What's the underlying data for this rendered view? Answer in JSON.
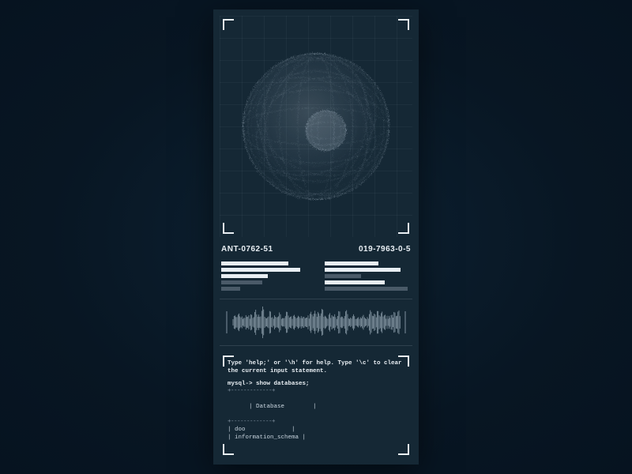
{
  "ids": {
    "left": "ANT-0762-51",
    "right": "019-7963-0-5"
  },
  "bars": {
    "left": [
      {
        "width": 78,
        "dim": false
      },
      {
        "width": 92,
        "dim": false
      },
      {
        "width": 54,
        "dim": false
      },
      {
        "width": 48,
        "dim": true
      },
      {
        "width": 22,
        "dim": true
      }
    ],
    "right": [
      {
        "width": 62,
        "dim": false
      },
      {
        "width": 88,
        "dim": false
      },
      {
        "width": 42,
        "dim": true
      },
      {
        "width": 70,
        "dim": false
      },
      {
        "width": 96,
        "dim": true
      }
    ]
  },
  "terminal": {
    "help": "Type 'help;' or '\\h' for help. Type '\\c' to clear the current input statement.",
    "prompt": "mysql-> show databases;",
    "table_top": "+-----------+",
    "header": "| Database",
    "header_end": "|",
    "rows": [
      "| doo",
      "| information_schema"
    ],
    "row_end": "|"
  },
  "colors": {
    "accent": "#e8eef3",
    "dim": "#4a5a68",
    "panel": "#152835"
  },
  "visualizer": {
    "object_name": "cell-sphere-wireframe"
  }
}
